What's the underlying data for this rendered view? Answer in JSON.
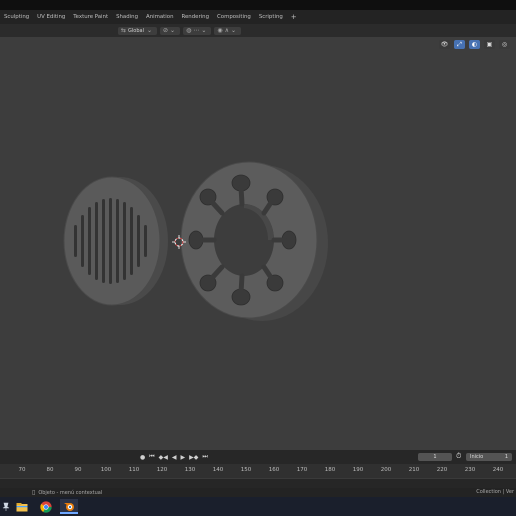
{
  "workspace_tabs": [
    "Sculpting",
    "UV Editing",
    "Texture Paint",
    "Shading",
    "Animation",
    "Rendering",
    "Compositing",
    "Scripting",
    "+"
  ],
  "header": {
    "orientation_label": "Global",
    "orientation_icon": "transform-orientation-icon",
    "pivot_icon": "pivot-point-icon",
    "snap_icon": "snap-icon",
    "proportional_icon": "proportional-editing-icon"
  },
  "playback": {
    "current_frame": "1",
    "start_label": "Inicio",
    "start_value": "1"
  },
  "timeline": {
    "ticks": [
      "70",
      "80",
      "90",
      "100",
      "110",
      "120",
      "130",
      "140",
      "150",
      "160",
      "170",
      "180",
      "190",
      "200",
      "210",
      "220",
      "230",
      "240"
    ]
  },
  "status": {
    "left_text": "Objeto - menú contextual",
    "right_text": "Collection | Ver"
  },
  "colors": {
    "viewport_bg": "#3d3d3d",
    "object_color": "#5a5a5a",
    "accent_blue": "#4772b3"
  }
}
